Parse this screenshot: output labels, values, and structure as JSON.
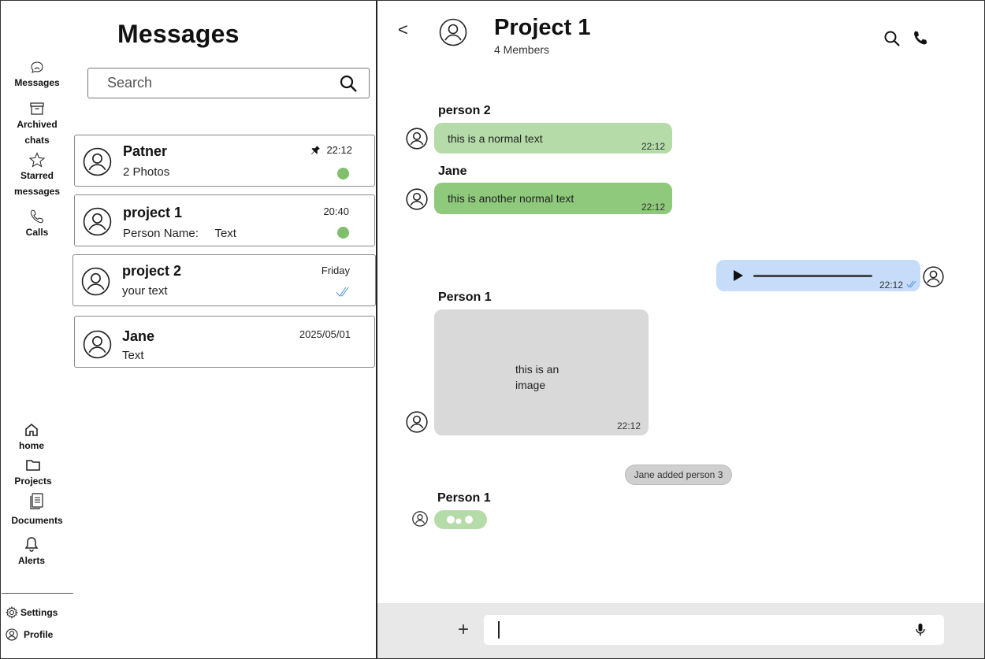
{
  "nav": {
    "items": [
      {
        "label": "Messages",
        "icon": "chat-bubble-icon"
      },
      {
        "label": "Archived chats",
        "icon": "archive-icon"
      },
      {
        "label": "Starred messages",
        "icon": "star-icon"
      },
      {
        "label": "Calls",
        "icon": "phone-icon"
      },
      {
        "label": "home",
        "icon": "home-icon"
      },
      {
        "label": "Projects",
        "icon": "folder-icon"
      },
      {
        "label": "Documents",
        "icon": "documents-icon"
      },
      {
        "label": "Alerts",
        "icon": "bell-icon"
      }
    ],
    "settings": "Settings",
    "profile": "Profile"
  },
  "list": {
    "title": "Messages",
    "search_placeholder": "Search",
    "conversations": [
      {
        "name": "Patner",
        "preview": "2 Photos",
        "time": "22:12",
        "pinned": true,
        "unread": true
      },
      {
        "name": "project 1",
        "preview": "Person Name:     Text",
        "time": "20:40",
        "pinned": false,
        "unread": true
      },
      {
        "name": "project 2",
        "preview": "your text",
        "time": "Friday",
        "pinned": false,
        "unread": false,
        "read_ticks": true
      },
      {
        "name": "Jane",
        "preview": "Text",
        "time": "2025/05/01",
        "pinned": false,
        "unread": false
      }
    ]
  },
  "chat": {
    "title": "Project 1",
    "subtitle": "4 Members",
    "messages": [
      {
        "sender": "person 2",
        "text": "this is a normal text",
        "time": "22:12",
        "color": "#b5dca8"
      },
      {
        "sender": "Jane",
        "text": "this is another normal text",
        "time": "22:12",
        "color": "#8ec97c"
      },
      {
        "type": "voice",
        "time": "22:12",
        "color": "#c6dcf8"
      },
      {
        "sender": "Person 1",
        "type": "image",
        "text": "this is an image",
        "time": "22:12",
        "color": "#d9d9d9"
      },
      {
        "type": "system",
        "text": "Jane added person 3"
      },
      {
        "sender": "Person 1",
        "type": "typing",
        "color": "#b5dca8"
      }
    ],
    "image_text_line1": "this is an",
    "image_text_line2": "image",
    "composer_placeholder": ""
  },
  "colors": {
    "unread_dot": "#7fbf6e",
    "composer_bg": "#e8e8e8",
    "read_tick": "#4a90d9"
  }
}
